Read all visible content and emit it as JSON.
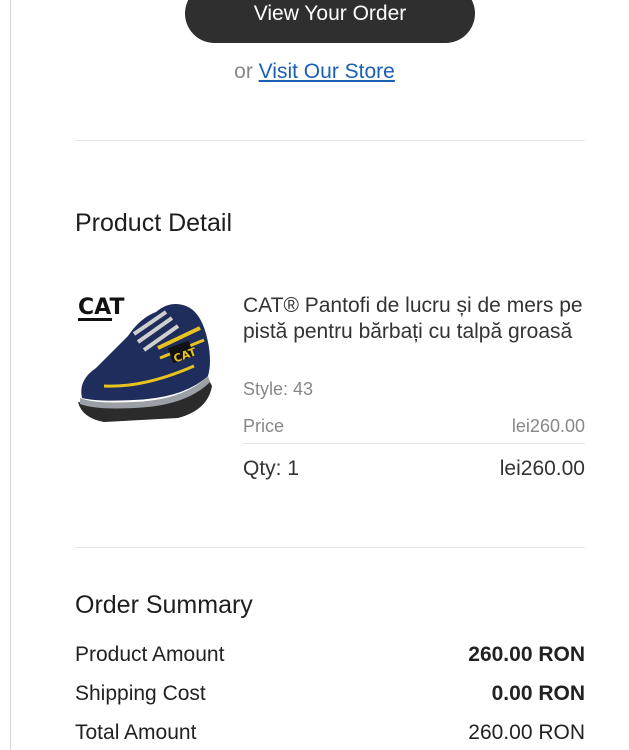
{
  "actions": {
    "view_order_label": "View Your Order",
    "or_text": "or",
    "visit_store_label": "Visit Our Store"
  },
  "product_detail": {
    "title": "Product Detail",
    "item": {
      "name": "CAT® Pantofi de lucru și de mers pe pistă pentru bărbați cu talpă groasă",
      "style": "Style: 43",
      "price_label": "Price",
      "price_value": "lei260.00",
      "qty": "Qty: 1",
      "line_total": "lei260.00",
      "image_icon": "shoe-icon",
      "image_brand_text": "CAT"
    }
  },
  "order_summary": {
    "title": "Order Summary",
    "rows": [
      {
        "label": "Product Amount",
        "value": "260.00 RON"
      },
      {
        "label": "Shipping Cost",
        "value": "0.00 RON"
      },
      {
        "label": "Total Amount",
        "value": "260.00 RON"
      }
    ]
  },
  "colors": {
    "button_bg": "#2f2f2f",
    "link": "#1a5fb4",
    "shoe_navy": "#1f2d5c",
    "shoe_accent": "#e8c21f"
  }
}
